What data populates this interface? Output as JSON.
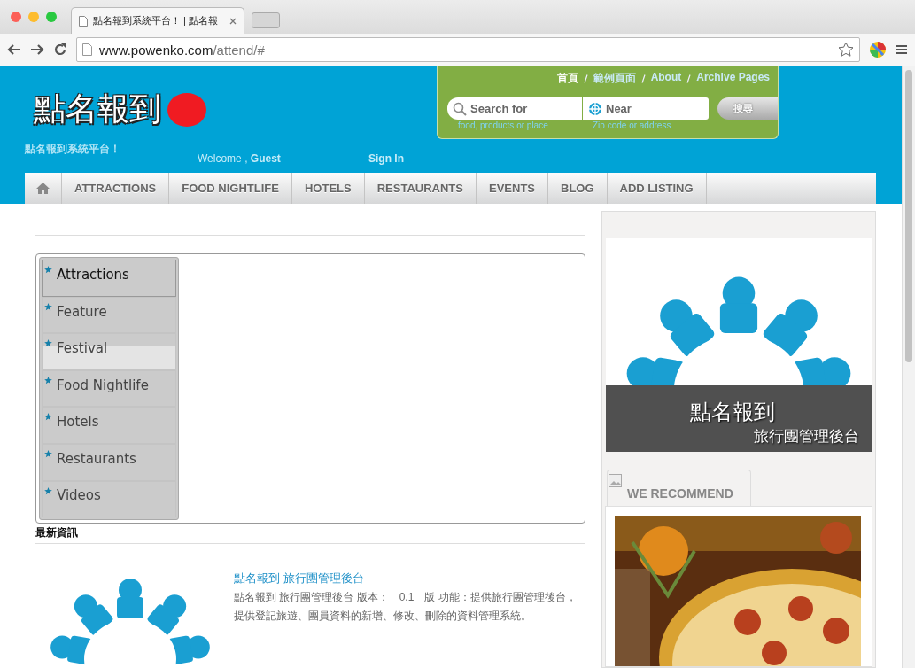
{
  "browser": {
    "tab_title": "點名報到系統平台！ | 點名報",
    "url_host": "www.powenko.com",
    "url_path": "/attend/#"
  },
  "header": {
    "logo": "點名報到",
    "tagline": "點名報到系統平台！",
    "welcome": "Welcome , ",
    "guest": "Guest",
    "sign_in": "Sign In",
    "top_links": [
      {
        "label": "首頁",
        "selected": true
      },
      {
        "label": "範例頁面",
        "selected": false
      },
      {
        "label": "About",
        "selected": false
      },
      {
        "label": "Archive Pages",
        "selected": false
      }
    ],
    "search": {
      "placeholder": "Search for",
      "hint": "food, products or place"
    },
    "near": {
      "placeholder": "Near",
      "hint": "Zip code or address"
    },
    "search_button": "搜尋"
  },
  "nav": [
    "ATTRACTIONS",
    "FOOD NIGHTLIFE",
    "HOTELS",
    "RESTAURANTS",
    "EVENTS",
    "BLOG",
    "ADD LISTING"
  ],
  "tabs": [
    {
      "label": "Attractions",
      "selected": true,
      "highlighted": false
    },
    {
      "label": "Feature",
      "selected": false,
      "highlighted": false
    },
    {
      "label": "Festival",
      "selected": false,
      "highlighted": true
    },
    {
      "label": "Food Nightlife",
      "selected": false,
      "highlighted": false
    },
    {
      "label": "Hotels",
      "selected": false,
      "highlighted": false
    },
    {
      "label": "Restaurants",
      "selected": false,
      "highlighted": false
    },
    {
      "label": "Videos",
      "selected": false,
      "highlighted": false
    }
  ],
  "news": {
    "heading": "最新資訊",
    "title": "點名報到 旅行團管理後台",
    "body": "點名報到 旅行團管理後台 版本：　0.1　版 功能：提供旅行團管理後台，提供登記旅遊、團員資料的新增、修改、刪除的資料管理系統。"
  },
  "banner": {
    "title": "點名報到",
    "subtitle": "旅行團管理後台"
  },
  "recommend": {
    "heading": "WE RECOMMEND"
  }
}
